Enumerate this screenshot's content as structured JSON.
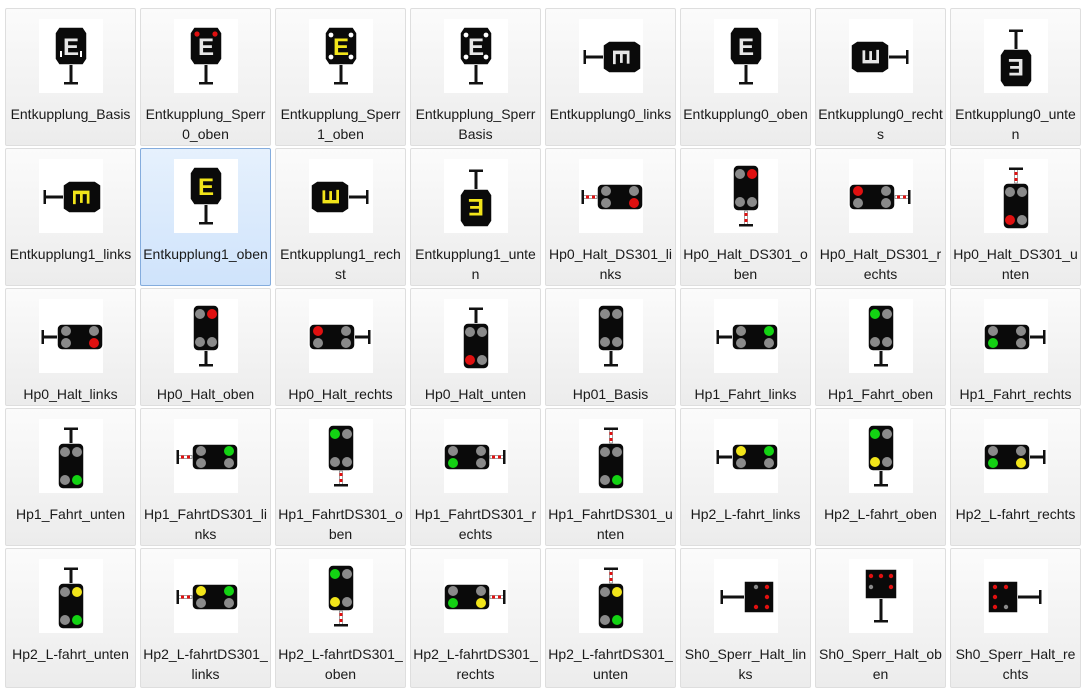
{
  "colors": {
    "red": "#e01010",
    "green": "#13d313",
    "yellow": "#f2e51a",
    "gray": "#8a8a8a",
    "plate": "#0a0a0a",
    "post": "#111111",
    "selection": "#cfe3fb"
  },
  "items": [
    {
      "label": "Entkupplung_Basis",
      "kind": "E",
      "orient": "oben",
      "ecolor": "white",
      "extras": "dots-small",
      "selected": false
    },
    {
      "label": "Entkupplung_Sperr0_oben",
      "kind": "E",
      "orient": "oben",
      "ecolor": "white",
      "extras": "dots-red",
      "selected": false
    },
    {
      "label": "Entkupplung_Sperr1_oben",
      "kind": "E",
      "orient": "oben",
      "ecolor": "yellow",
      "extras": "dots-white",
      "selected": false
    },
    {
      "label": "Entkupplung_SperrBasis",
      "kind": "E",
      "orient": "oben",
      "ecolor": "white",
      "extras": "dots-white",
      "selected": false
    },
    {
      "label": "Entkupplung0_links",
      "kind": "E",
      "orient": "links",
      "ecolor": "white",
      "extras": "none",
      "selected": false
    },
    {
      "label": "Entkupplung0_oben",
      "kind": "E",
      "orient": "oben",
      "ecolor": "white",
      "extras": "none",
      "selected": false
    },
    {
      "label": "Entkupplung0_rechts",
      "kind": "E",
      "orient": "rechts",
      "ecolor": "white",
      "extras": "none",
      "selected": false
    },
    {
      "label": "Entkupplung0_unten",
      "kind": "E",
      "orient": "unten",
      "ecolor": "white",
      "extras": "none",
      "selected": false
    },
    {
      "label": "Entkupplung1_links",
      "kind": "E",
      "orient": "links",
      "ecolor": "yellow",
      "extras": "none",
      "selected": false
    },
    {
      "label": "Entkupplung1_oben",
      "kind": "E",
      "orient": "oben",
      "ecolor": "yellow",
      "extras": "none",
      "selected": true
    },
    {
      "label": "Entkupplung1_rechst",
      "kind": "E",
      "orient": "rechts",
      "ecolor": "yellow",
      "extras": "none",
      "selected": false
    },
    {
      "label": "Entkupplung1_unten",
      "kind": "E",
      "orient": "unten",
      "ecolor": "yellow",
      "extras": "none",
      "selected": false
    },
    {
      "label": "Hp0_Halt_DS301_links",
      "kind": "L",
      "orient": "links",
      "lamps": [
        "gray",
        "red",
        "gray",
        "gray"
      ],
      "striped": true,
      "selected": false
    },
    {
      "label": "Hp0_Halt_DS301_oben",
      "kind": "L",
      "orient": "oben",
      "lamps": [
        "gray",
        "red",
        "gray",
        "gray"
      ],
      "striped": true,
      "selected": false
    },
    {
      "label": "Hp0_Halt_DS301_rechts",
      "kind": "L",
      "orient": "rechts",
      "lamps": [
        "gray",
        "red",
        "gray",
        "gray"
      ],
      "striped": true,
      "selected": false
    },
    {
      "label": "Hp0_Halt_DS301_unten",
      "kind": "L",
      "orient": "unten",
      "lamps": [
        "gray",
        "red",
        "gray",
        "gray"
      ],
      "striped": true,
      "selected": false
    },
    {
      "label": "Hp0_Halt_links",
      "kind": "L",
      "orient": "links",
      "lamps": [
        "gray",
        "red",
        "gray",
        "gray"
      ],
      "striped": false,
      "selected": false
    },
    {
      "label": "Hp0_Halt_oben",
      "kind": "L",
      "orient": "oben",
      "lamps": [
        "gray",
        "red",
        "gray",
        "gray"
      ],
      "striped": false,
      "selected": false
    },
    {
      "label": "Hp0_Halt_rechts",
      "kind": "L",
      "orient": "rechts",
      "lamps": [
        "gray",
        "red",
        "gray",
        "gray"
      ],
      "striped": false,
      "selected": false
    },
    {
      "label": "Hp0_Halt_unten",
      "kind": "L",
      "orient": "unten",
      "lamps": [
        "gray",
        "red",
        "gray",
        "gray"
      ],
      "striped": false,
      "selected": false
    },
    {
      "label": "Hp01_Basis",
      "kind": "L",
      "orient": "oben",
      "lamps": [
        "gray",
        "gray",
        "gray",
        "gray"
      ],
      "striped": false,
      "selected": false
    },
    {
      "label": "Hp1_Fahrt_links",
      "kind": "L",
      "orient": "links",
      "lamps": [
        "green",
        "gray",
        "gray",
        "gray"
      ],
      "striped": false,
      "selected": false
    },
    {
      "label": "Hp1_Fahrt_oben",
      "kind": "L",
      "orient": "oben",
      "lamps": [
        "green",
        "gray",
        "gray",
        "gray"
      ],
      "striped": false,
      "selected": false
    },
    {
      "label": "Hp1_Fahrt_rechts",
      "kind": "L",
      "orient": "rechts",
      "lamps": [
        "green",
        "gray",
        "gray",
        "gray"
      ],
      "striped": false,
      "selected": false
    },
    {
      "label": "Hp1_Fahrt_unten",
      "kind": "L",
      "orient": "unten",
      "lamps": [
        "green",
        "gray",
        "gray",
        "gray"
      ],
      "striped": false,
      "selected": false
    },
    {
      "label": "Hp1_FahrtDS301_links",
      "kind": "L",
      "orient": "links",
      "lamps": [
        "green",
        "gray",
        "gray",
        "gray"
      ],
      "striped": true,
      "selected": false
    },
    {
      "label": "Hp1_FahrtDS301_oben",
      "kind": "L",
      "orient": "oben",
      "lamps": [
        "green",
        "gray",
        "gray",
        "gray"
      ],
      "striped": true,
      "selected": false
    },
    {
      "label": "Hp1_FahrtDS301_rechts",
      "kind": "L",
      "orient": "rechts",
      "lamps": [
        "green",
        "gray",
        "gray",
        "gray"
      ],
      "striped": true,
      "selected": false
    },
    {
      "label": "Hp1_FahrtDS301_unten",
      "kind": "L",
      "orient": "unten",
      "lamps": [
        "green",
        "gray",
        "gray",
        "gray"
      ],
      "striped": true,
      "selected": false
    },
    {
      "label": "Hp2_L-fahrt_links",
      "kind": "L",
      "orient": "links",
      "lamps": [
        "green",
        "gray",
        "yellow",
        "gray"
      ],
      "striped": false,
      "selected": false
    },
    {
      "label": "Hp2_L-fahrt_oben",
      "kind": "L",
      "orient": "oben",
      "lamps": [
        "green",
        "gray",
        "yellow",
        "gray"
      ],
      "striped": false,
      "selected": false
    },
    {
      "label": "Hp2_L-fahrt_rechts",
      "kind": "L",
      "orient": "rechts",
      "lamps": [
        "green",
        "gray",
        "yellow",
        "gray"
      ],
      "striped": false,
      "selected": false
    },
    {
      "label": "Hp2_L-fahrt_unten",
      "kind": "L",
      "orient": "unten",
      "lamps": [
        "green",
        "gray",
        "yellow",
        "gray"
      ],
      "striped": false,
      "selected": false
    },
    {
      "label": "Hp2_L-fahrtDS301_links",
      "kind": "L",
      "orient": "links",
      "lamps": [
        "green",
        "gray",
        "yellow",
        "gray"
      ],
      "striped": true,
      "selected": false
    },
    {
      "label": "Hp2_L-fahrtDS301_oben",
      "kind": "L",
      "orient": "oben",
      "lamps": [
        "green",
        "gray",
        "yellow",
        "gray"
      ],
      "striped": true,
      "selected": false
    },
    {
      "label": "Hp2_L-fahrtDS301_rechts",
      "kind": "L",
      "orient": "rechts",
      "lamps": [
        "green",
        "gray",
        "yellow",
        "gray"
      ],
      "striped": true,
      "selected": false
    },
    {
      "label": "Hp2_L-fahrtDS301_unten",
      "kind": "L",
      "orient": "unten",
      "lamps": [
        "green",
        "gray",
        "yellow",
        "gray"
      ],
      "striped": true,
      "selected": false
    },
    {
      "label": "Sh0_Sperr_Halt_links",
      "kind": "S",
      "orient": "links",
      "selected": false
    },
    {
      "label": "Sh0_Sperr_Halt_oben",
      "kind": "S",
      "orient": "oben",
      "selected": false
    },
    {
      "label": "Sh0_Sperr_Halt_rechts",
      "kind": "S",
      "orient": "rechts",
      "selected": false
    }
  ]
}
